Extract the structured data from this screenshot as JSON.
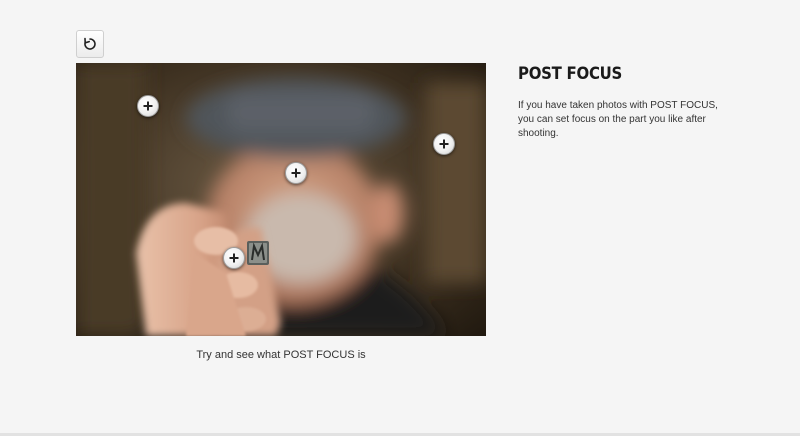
{
  "controls": {
    "refresh_icon": "refresh-icon"
  },
  "demo": {
    "caption": "Try and see what POST FOCUS is",
    "focus_points": [
      {
        "name": "focus-point-top-left",
        "icon": "plus-icon"
      },
      {
        "name": "focus-point-right",
        "icon": "plus-icon"
      },
      {
        "name": "focus-point-face",
        "icon": "plus-icon"
      },
      {
        "name": "focus-point-hand",
        "icon": "plus-icon"
      }
    ]
  },
  "info": {
    "title": "POST FOCUS",
    "description": "If you have taken photos with POST FOCUS, you can set focus on the part you like after shooting."
  },
  "colors": {
    "background": "#f5f5f5",
    "text": "#333333",
    "title": "#1a1a1a"
  }
}
